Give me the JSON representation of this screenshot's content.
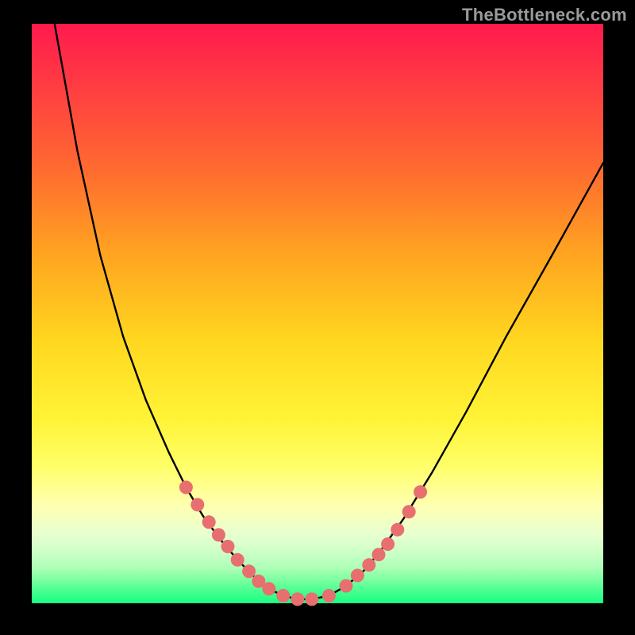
{
  "watermark": "TheBottleneck.com",
  "colors": {
    "background": "#000000",
    "curve": "#000000",
    "dot_fill": "#e76f6f",
    "dot_stroke": "#c55757"
  },
  "chart_data": {
    "type": "line",
    "title": "",
    "xlabel": "",
    "ylabel": "",
    "xlim": [
      0,
      100
    ],
    "ylim": [
      0,
      100
    ],
    "note": "V-shaped bottleneck curve; y-axis inverted (0 at top, 100 at bottom). Visual only — no numeric axes shown.",
    "series": [
      {
        "name": "curve",
        "x": [
          4,
          8,
          12,
          16,
          20,
          24,
          27,
          30,
          33,
          36,
          39,
          41.5,
          44,
          46.5,
          49,
          52,
          55,
          58,
          61,
          65,
          70,
          76,
          83,
          91,
          100
        ],
        "y": [
          0,
          22,
          40,
          54,
          65,
          74,
          80,
          85,
          89,
          92.5,
          95.5,
          97.5,
          98.7,
          99.3,
          99.3,
          98.7,
          97,
          94.5,
          91,
          85.5,
          77.5,
          67,
          54,
          40,
          24
        ]
      }
    ],
    "highlight_dots": {
      "name": "markers",
      "x": [
        27,
        29,
        31,
        32.7,
        34.3,
        36,
        38,
        39.7,
        41.5,
        44,
        46.5,
        49,
        52,
        55,
        57,
        59,
        60.7,
        62.3,
        64,
        66,
        68
      ],
      "y": [
        80,
        83,
        86,
        88.2,
        90.2,
        92.5,
        94.5,
        96.2,
        97.5,
        98.7,
        99.3,
        99.3,
        98.7,
        97,
        95.2,
        93.4,
        91.6,
        89.8,
        87.3,
        84.2,
        80.8
      ]
    }
  }
}
